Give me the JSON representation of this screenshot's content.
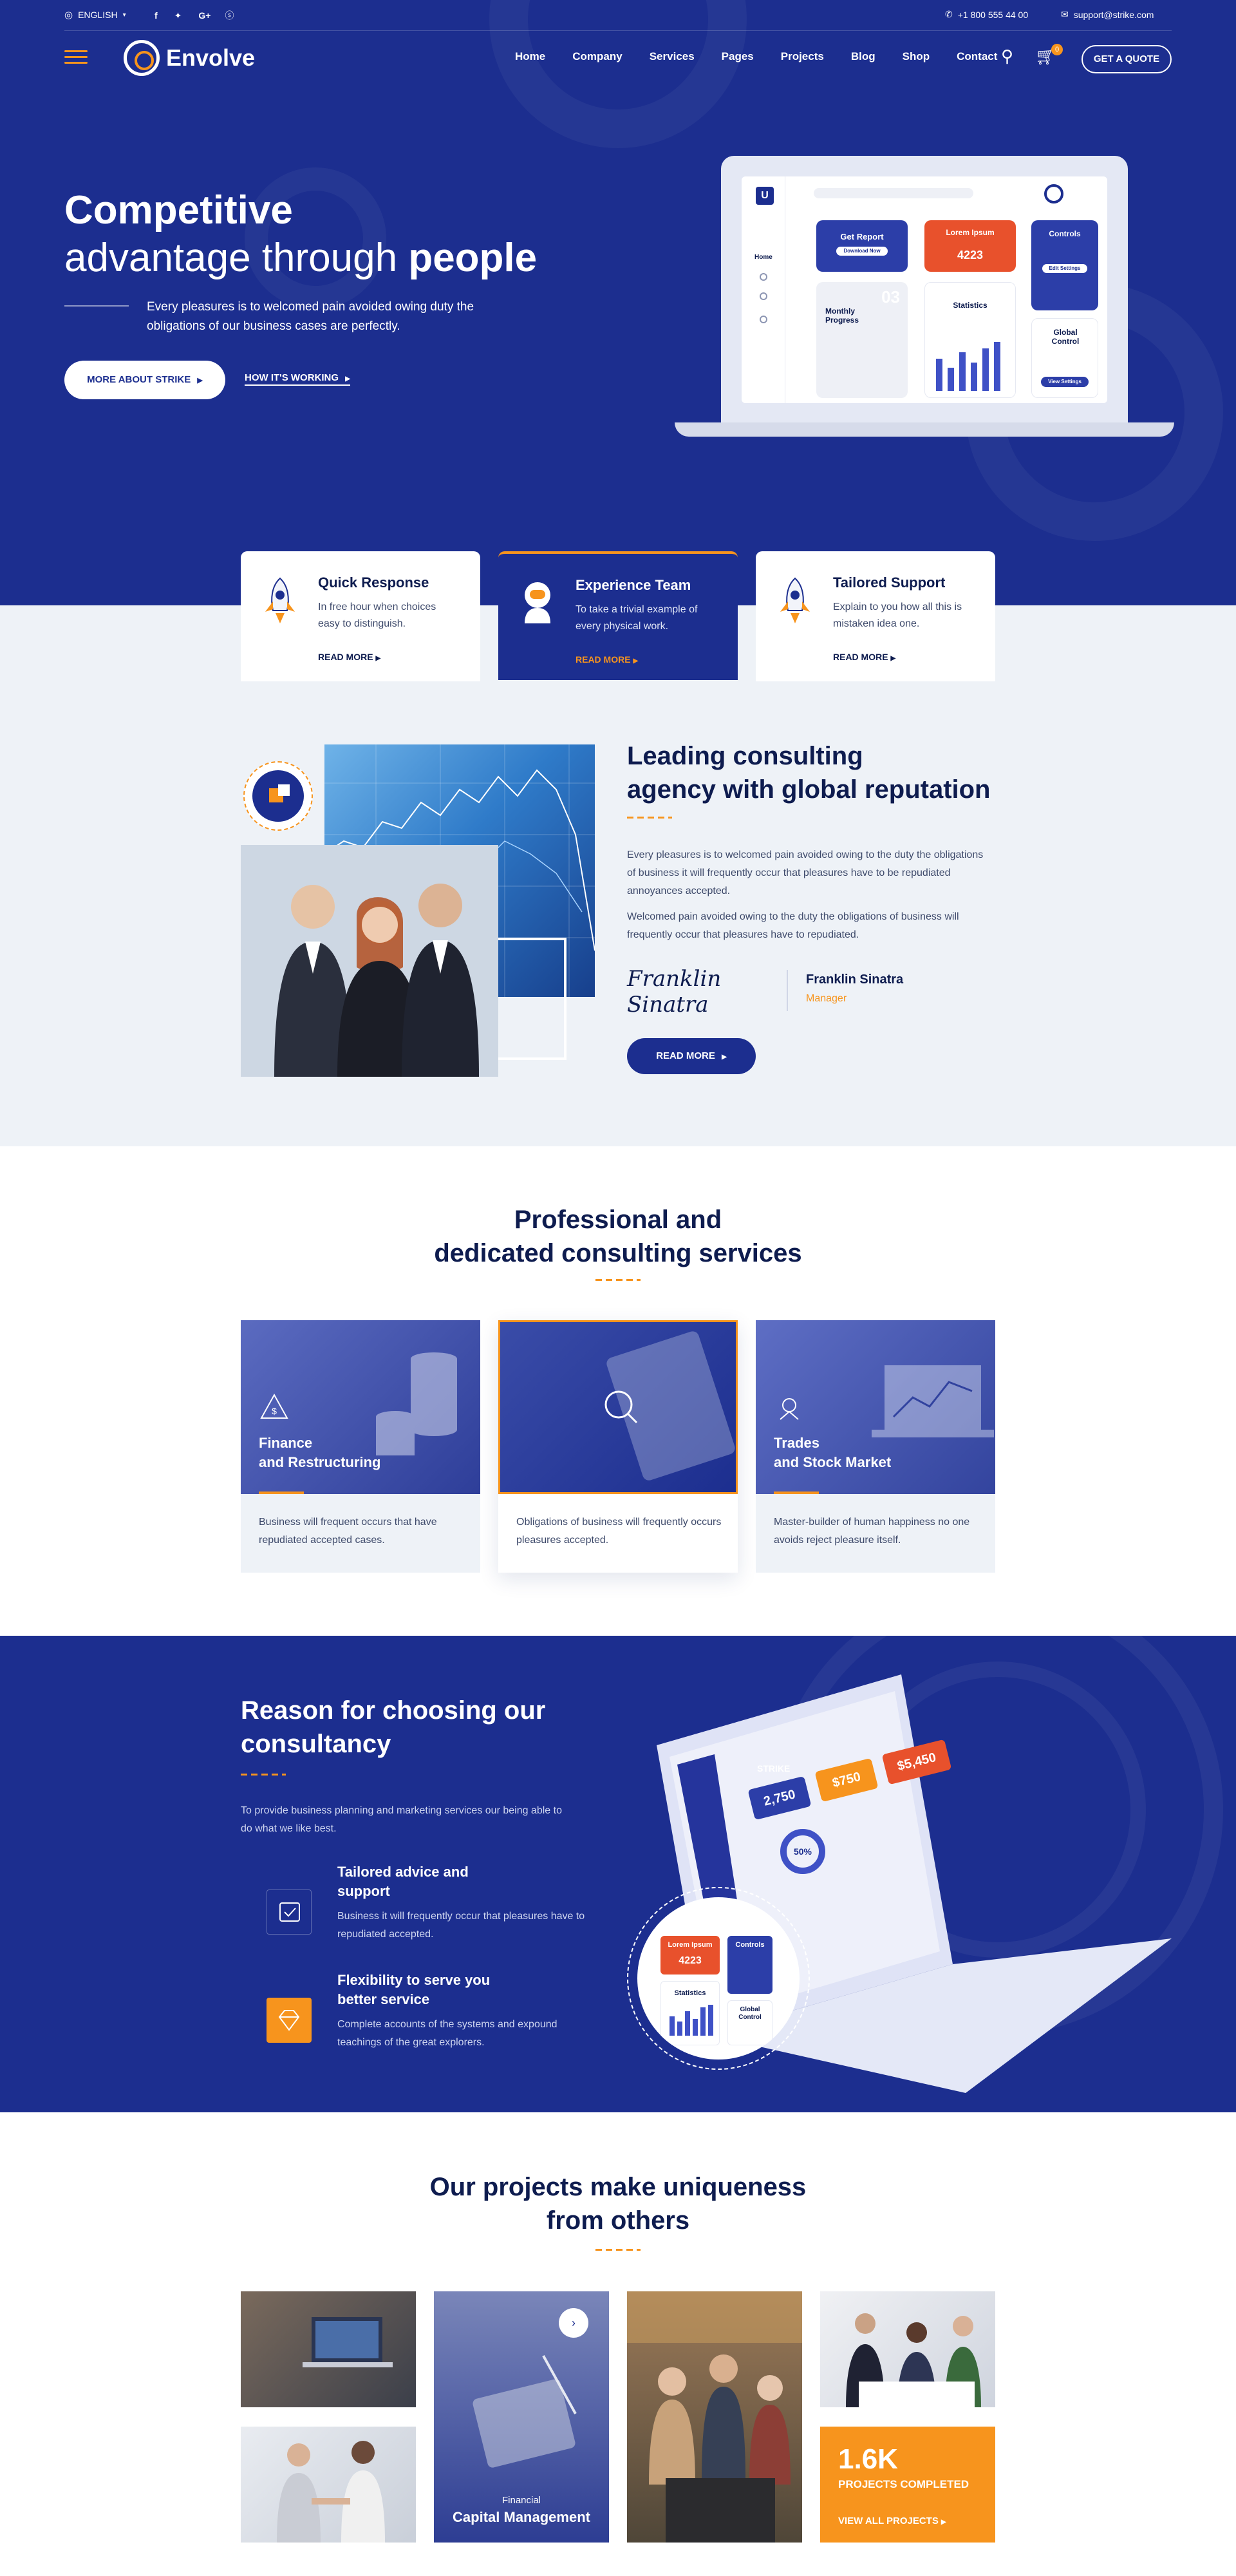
{
  "topbar": {
    "language": "ENGLISH",
    "social": [
      "f",
      "twitter",
      "G+",
      "skype"
    ],
    "phone": "+1 800 555 44 00",
    "email": "support@strike.com"
  },
  "nav": {
    "brand": "Envolve",
    "links": [
      "Home",
      "Company",
      "Services",
      "Pages",
      "Projects",
      "Blog",
      "Shop",
      "Contact"
    ],
    "cart_count": "0",
    "quote_label": "GET A QUOTE"
  },
  "hero": {
    "title_bold": "Competitive",
    "title_line2_light": "advantage through ",
    "title_line2_bold": "people",
    "description": "Every pleasures is to welcomed pain avoided owing duty the obligations of our business cases are perfectly.",
    "primary_button": "MORE ABOUT STRIKE",
    "secondary_link": "HOW IT'S WORKING",
    "dashboard": {
      "logo": "U",
      "side_label": "Home",
      "card1": "Get Report",
      "card1_btn": "Download Now",
      "card2": "Lorem Ipsum",
      "card2_value": "4223",
      "card3": "Controls",
      "card3_btn": "Edit Settings",
      "card4": "Monthly Progress",
      "card4_num": "03",
      "card5": "Statistics",
      "card6": "Global Control",
      "card6_btn": "View Settings"
    }
  },
  "features": [
    {
      "title": "Quick Response",
      "text": "In free hour when choices easy to distinguish.",
      "link": "READ MORE"
    },
    {
      "title": "Experience Team",
      "text": "To take a trivial example of every physical work.",
      "link": "READ MORE"
    },
    {
      "title": "Tailored Support",
      "text": "Explain to you how all this is mistaken idea one.",
      "link": "READ MORE"
    }
  ],
  "about": {
    "title_line1": "Leading consulting",
    "title_line2": "agency with global reputation",
    "paragraph1": "Every pleasures is to welcomed pain avoided owing to the duty the obligations of business it will frequently occur that pleasures have to be repudiated annoyances accepted.",
    "paragraph2": "Welcomed pain avoided owing to the duty the obligations of business will frequently occur that pleasures have to repudiated.",
    "signature": "Franklin Sinatra",
    "name": "Franklin Sinatra",
    "role": "Manager",
    "button": "READ MORE"
  },
  "services": {
    "title_line1": "Professional and",
    "title_line2": "dedicated consulting services",
    "items": [
      {
        "title_line1": "Finance",
        "title_line2": "and Restructuring",
        "text": "Business will frequent occurs that have repudiated accepted cases."
      },
      {
        "title_line1": "",
        "title_line2": "",
        "text": "Obligations of business will frequently occurs pleasures accepted."
      },
      {
        "title_line1": "Trades",
        "title_line2": "and Stock Market",
        "text": "Master-builder of human happiness no one avoids reject  pleasure itself."
      }
    ]
  },
  "reasons": {
    "title_line1": "Reason for choosing our",
    "title_line2": "consultancy",
    "description": "To provide business planning and marketing services our being able to do what we like best.",
    "items": [
      {
        "title_line1": "Tailored advice and",
        "title_line2": "support",
        "text": "Business it will frequently occur that pleasures have to repudiated accepted."
      },
      {
        "title_line1": "Flexibility to serve you",
        "title_line2": "better service",
        "text": "Complete accounts of the systems and expound teachings of the great explorers."
      }
    ],
    "dashboard": {
      "brand": "STRIKE",
      "stat1": "2,750",
      "stat2": "$750",
      "stat3": "$5,450",
      "percent": "50%",
      "circle_card1": "Lorem Ipsum",
      "circle_value": "4223",
      "circle_card2": "Controls",
      "circle_card3": "Statistics",
      "circle_card4": "Global Control"
    }
  },
  "projects": {
    "title_line1": "Our projects make uniqueness",
    "title_line2": "from others",
    "featured_small": "Financial",
    "featured_title": "Capital Management",
    "count": "1.6K",
    "count_label": "PROJECTS COMPLETED",
    "link": "VIEW ALL PROJECTS"
  }
}
